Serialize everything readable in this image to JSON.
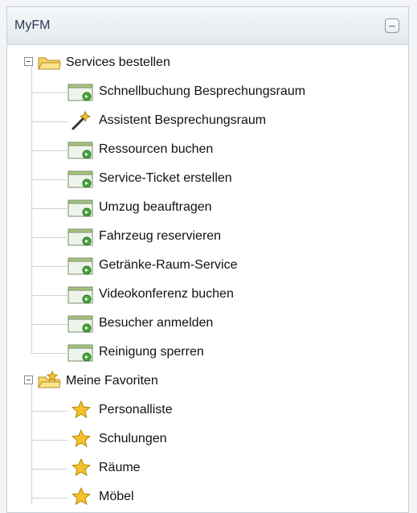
{
  "panel": {
    "title": "MyFM",
    "collapse_icon": "minus-icon"
  },
  "tree": {
    "groups": [
      {
        "label": "Services bestellen",
        "icon": "folder-open-icon",
        "items": [
          {
            "label": "Schnellbuchung Besprechungsraum",
            "icon": "service-form-icon"
          },
          {
            "label": "Assistent Besprechungsraum",
            "icon": "magic-wand-icon"
          },
          {
            "label": "Ressourcen buchen",
            "icon": "service-form-icon"
          },
          {
            "label": "Service-Ticket erstellen",
            "icon": "service-form-icon"
          },
          {
            "label": "Umzug beauftragen",
            "icon": "service-form-icon"
          },
          {
            "label": "Fahrzeug reservieren",
            "icon": "service-form-icon"
          },
          {
            "label": "Getränke-Raum-Service",
            "icon": "service-form-icon"
          },
          {
            "label": "Videokonferenz buchen",
            "icon": "service-form-icon"
          },
          {
            "label": "Besucher anmelden",
            "icon": "service-form-icon"
          },
          {
            "label": "Reinigung sperren",
            "icon": "service-form-icon"
          }
        ]
      },
      {
        "label": "Meine Favoriten",
        "icon": "favorites-folder-icon",
        "items": [
          {
            "label": "Personalliste",
            "icon": "star-icon"
          },
          {
            "label": "Schulungen",
            "icon": "star-icon"
          },
          {
            "label": "Räume",
            "icon": "star-icon"
          },
          {
            "label": "Möbel",
            "icon": "star-icon"
          }
        ]
      }
    ]
  }
}
